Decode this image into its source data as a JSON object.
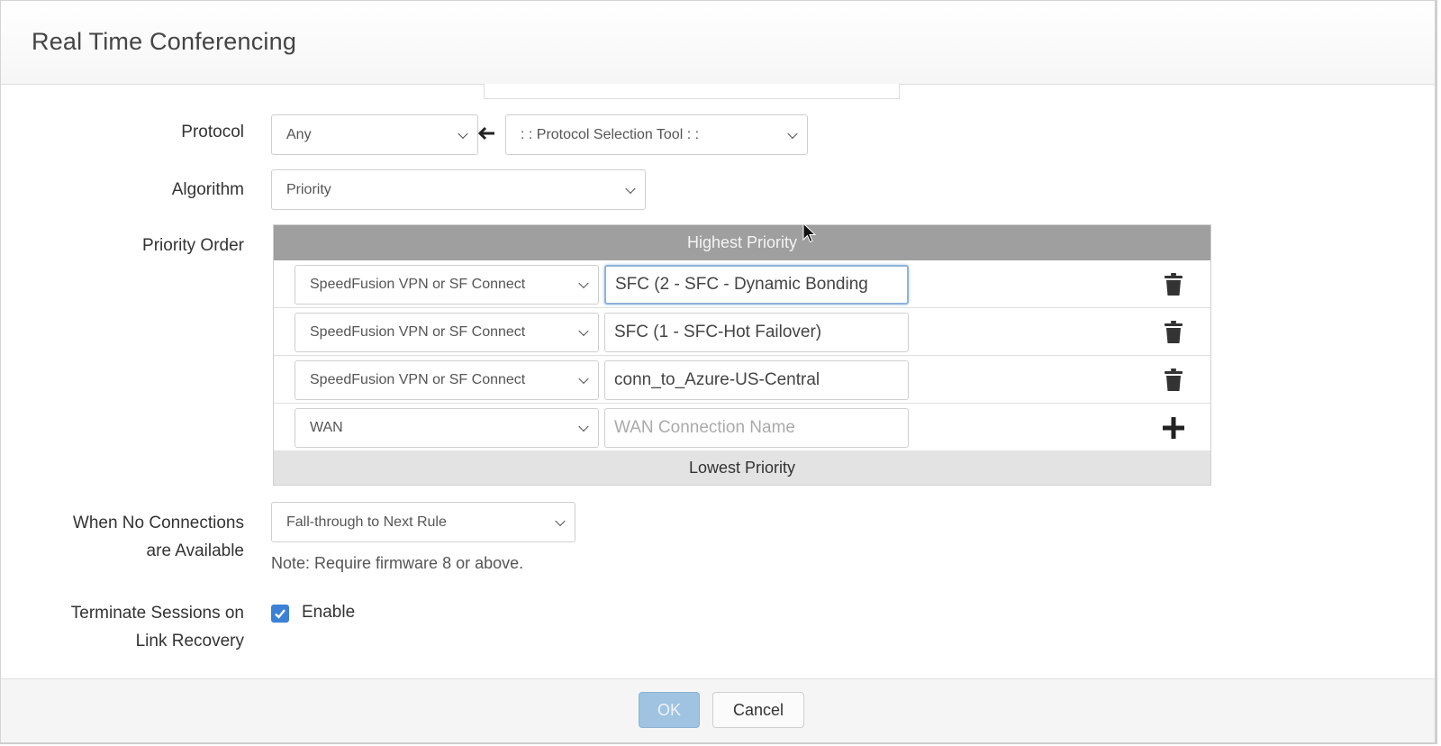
{
  "dialog": {
    "title": "Real Time Conferencing"
  },
  "protocol": {
    "label": "Protocol",
    "value": "Any",
    "tool_value": ": : Protocol Selection Tool : :"
  },
  "algorithm": {
    "label": "Algorithm",
    "value": "Priority"
  },
  "priority_order": {
    "label": "Priority Order",
    "header": "Highest Priority",
    "footer": "Lowest Priority",
    "rows": [
      {
        "type": "SpeedFusion VPN or SF Connect",
        "name": "SFC (2 - SFC - Dynamic Bonding"
      },
      {
        "type": "SpeedFusion VPN or SF Connect",
        "name": "SFC (1 - SFC-Hot Failover)"
      },
      {
        "type": "SpeedFusion VPN or SF Connect",
        "name": "conn_to_Azure-US-Central"
      }
    ],
    "new_row": {
      "type": "WAN",
      "placeholder": "WAN Connection Name"
    }
  },
  "no_connections": {
    "label_line1": "When No Connections",
    "label_line2": "are Available",
    "value": "Fall-through to Next Rule",
    "note": "Note: Require firmware 8 or above."
  },
  "terminate": {
    "label_line1": "Terminate Sessions on",
    "label_line2": "Link Recovery",
    "checkbox_label": "Enable",
    "checked": true
  },
  "footer": {
    "ok_label": "OK",
    "cancel_label": "Cancel"
  },
  "icons": {
    "arrow": "arrow-left-icon",
    "delete": "trash-icon",
    "add": "plus-icon",
    "dropdown": "chevron-down-icon"
  },
  "colors": {
    "header_bar": "#9f9f9f",
    "footer_bar": "#e3e3e3",
    "checkbox": "#3b82d6",
    "ok_button": "#9fc3e0"
  }
}
